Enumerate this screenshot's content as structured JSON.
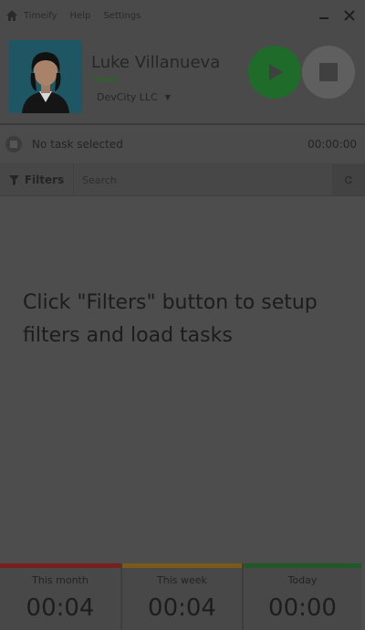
{
  "app": {
    "title": "Timeify"
  },
  "menu": {
    "items": [
      "Help",
      "Settings"
    ]
  },
  "window": {
    "minimize": "–",
    "close": "✕"
  },
  "user": {
    "name": "Luke Villanueva",
    "status": "Online",
    "company": "DevCity LLC",
    "avatar_icon": "user-avatar"
  },
  "controls": {
    "play_icon": "play-icon",
    "stop_icon": "stop-icon",
    "play_color": "#1f6b2a",
    "stop_color": "#5f5f5f"
  },
  "current_task": {
    "label": "No task selected",
    "time": "00:00:00"
  },
  "filters": {
    "button_label": "Filters",
    "search_placeholder": "Search"
  },
  "empty_state": {
    "message": "Click \"Filters\" button to setup filters and load tasks"
  },
  "stats": [
    {
      "label": "This month",
      "value": "00:04",
      "color": "#7a1f1f"
    },
    {
      "label": "This week",
      "value": "00:04",
      "color": "#7a5a1a"
    },
    {
      "label": "Today",
      "value": "00:00",
      "color": "#1f5a26"
    }
  ]
}
